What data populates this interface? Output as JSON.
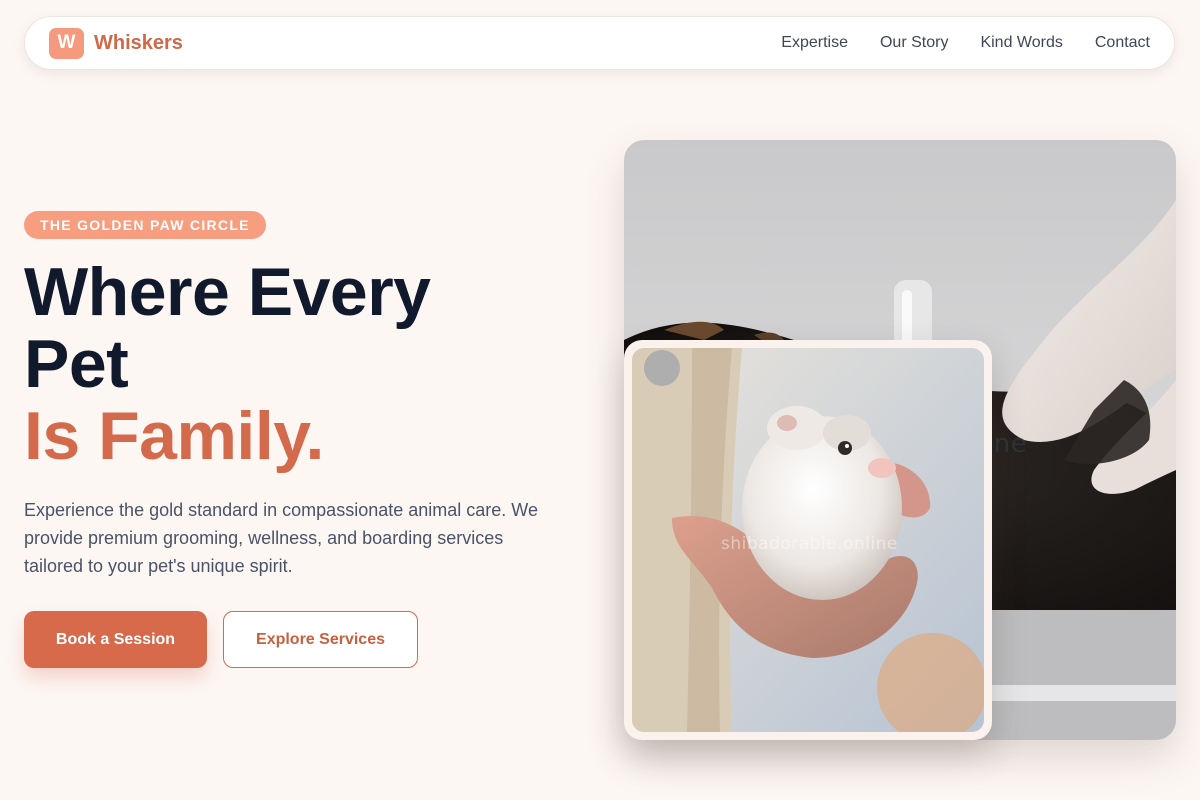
{
  "nav": {
    "logo_letter": "W",
    "brand": "Whiskers",
    "links": [
      "Expertise",
      "Our Story",
      "Kind Words",
      "Contact"
    ]
  },
  "hero": {
    "badge": "THE GOLDEN PAW CIRCLE",
    "headline_line1": "Where Every",
    "headline_line2": "Pet",
    "headline_accent": "Is Family.",
    "lede": "Experience the gold standard in compassionate animal care. We provide premium grooming, wellness, and boarding services tailored to your pet's unique spirit.",
    "primary_cta": "Book a Session",
    "secondary_cta": "Explore Services"
  },
  "images": {
    "main_alt": "Veterinarian in gloves examining a dark-coated dog",
    "inset_alt": "White hamster held in a person's hand",
    "watermark_main": "ine",
    "watermark_inset": "shibadorable.online"
  },
  "colors": {
    "accent": "#d66a4b",
    "badge": "#f89e80",
    "heading": "#111a2c",
    "background": "#fdf7f4"
  }
}
